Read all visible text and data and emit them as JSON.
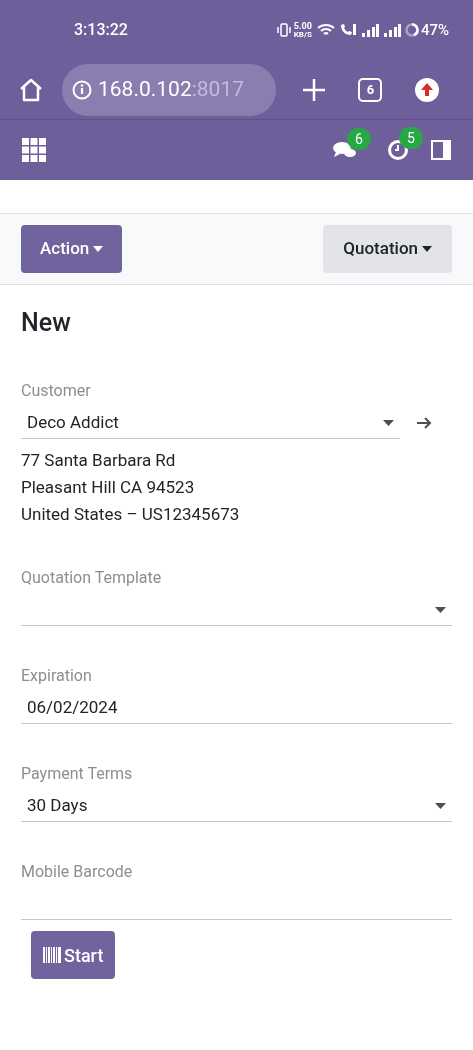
{
  "status_bar": {
    "time": "3:13:22",
    "net_speed": "5.00",
    "net_unit": "KB/S",
    "battery": "47%"
  },
  "browser": {
    "url_host": "168.0.102",
    "url_port": ":8017",
    "tab_count": "6"
  },
  "navbar": {
    "messages_badge": "6",
    "activities_badge": "5"
  },
  "control_panel": {
    "action_button": "Action",
    "status_button": "Quotation"
  },
  "form": {
    "title": "New",
    "fields": [
      {
        "kind": "dropdown",
        "label": "Customer",
        "value": "Deco Addict",
        "link_arrow": true,
        "address": [
          "77 Santa Barbara Rd",
          "Pleasant Hill CA 94523",
          "United States – US12345673"
        ]
      },
      {
        "kind": "dropdown",
        "label": "Quotation Template"
      },
      {
        "kind": "text",
        "label": "Expiration",
        "value": "06/02/2024"
      },
      {
        "kind": "dropdown",
        "label": "Payment Terms",
        "value": "30 Days"
      },
      {
        "kind": "text",
        "label": "Mobile Barcode"
      }
    ],
    "start_button": "Start"
  }
}
